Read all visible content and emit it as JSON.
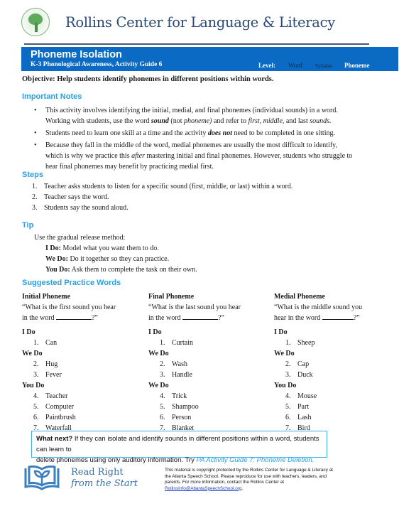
{
  "header": {
    "brand": "Rollins Center for Language & Literacy",
    "logo_icon": "tree-seal-icon"
  },
  "title_bar": {
    "title": "Phoneme Isolation",
    "subtitle": "K-3 Phonological Awareness, Activity Guide 6",
    "level_label": "Level:",
    "levels": [
      "Word",
      "Syllable",
      "Phoneme"
    ],
    "active_level": "Phoneme",
    "color": "#0b6bc4"
  },
  "objective": "Objective: Help students identify phonemes in different positions within words.",
  "important_notes": {
    "heading": "Important Notes",
    "items": [
      {
        "line1": "This activity involves identifying the initial, medial, and final phonemes (individual sounds) in a word.",
        "line2_a": "Working with students, use the word ",
        "line2_b": "sound",
        "line2_c": " (not ",
        "line2_d": "phoneme)",
        "line2_e": " and refer to ",
        "line2_f": "first, middle,",
        "line2_g": " and last ",
        "line2_h": "sounds."
      },
      {
        "a": "Students need to learn one skill at a time and the activity ",
        "b": "does not",
        "c": " need to be completed in one sitting."
      },
      {
        "line1": "Because they fall in the middle of the word, medial phonemes are usually the most difficult to identify,",
        "line2_a": "which is why we practice this ",
        "line2_b": "after",
        "line2_c": " mastering initial and final phonemes. However, students who struggle to",
        "line3": "hear final phonemes may benefit by practicing medial first."
      }
    ]
  },
  "steps": {
    "heading": "Steps",
    "items": [
      {
        "num": "1.",
        "text": "Teacher asks students to listen for a specific sound (first, middle, or last) within a word."
      },
      {
        "num": "2.",
        "text": "Teacher says the word."
      },
      {
        "num": "3.",
        "text": "Students say the sound aloud."
      }
    ]
  },
  "tip": {
    "heading": "Tip",
    "intro": "Use the gradual release method:",
    "rows": [
      {
        "label": "I Do:",
        "text": " Model what you want them to do."
      },
      {
        "label": "We Do:",
        "text": " Do it together so they can practice."
      },
      {
        "label": "You Do:",
        "text": " Ask them to complete the task on their own."
      }
    ]
  },
  "practice": {
    "heading": "Suggested Practice Words",
    "columns": [
      {
        "title": "Initial Phoneme",
        "prompt_line1": "“What is the first sound you hear",
        "prompt_line2": "in the word ",
        "prompt_end": "?”",
        "groups": [
          {
            "label": "I Do",
            "items": [
              {
                "num": "1.",
                "word": "Can"
              }
            ]
          },
          {
            "label": "We Do",
            "items": [
              {
                "num": "2.",
                "word": "Hug"
              },
              {
                "num": "3.",
                "word": "Fever"
              }
            ]
          },
          {
            "label": "You Do",
            "items": [
              {
                "num": "4.",
                "word": "Teacher"
              },
              {
                "num": "5.",
                "word": "Computer"
              },
              {
                "num": "6.",
                "word": "Paintbrush"
              },
              {
                "num": "7.",
                "word": "Waterfall"
              }
            ]
          }
        ]
      },
      {
        "title": "Final Phoneme",
        "prompt_line1": "“What is the last sound you hear",
        "prompt_line2": "in the word ",
        "prompt_end": "?”",
        "groups": [
          {
            "label": "I Do",
            "items": [
              {
                "num": "1.",
                "word": "Curtain"
              }
            ]
          },
          {
            "label": "We Do",
            "items": [
              {
                "num": "2.",
                "word": "Wash"
              },
              {
                "num": "3.",
                "word": "Handle"
              }
            ]
          },
          {
            "label": "We Do",
            "items": [
              {
                "num": "4.",
                "word": "Trick"
              },
              {
                "num": "5.",
                "word": "Shampoo"
              },
              {
                "num": "6.",
                "word": "Person"
              },
              {
                "num": "7.",
                "word": "Blanket"
              }
            ]
          }
        ]
      },
      {
        "title": "Medial Phoneme",
        "prompt_line1": "“What is the middle sound you",
        "prompt_line2": "hear in the word ",
        "prompt_end": "?”",
        "groups": [
          {
            "label": "I Do",
            "items": [
              {
                "num": "1.",
                "word": "Sheep"
              }
            ]
          },
          {
            "label": "We Do",
            "items": [
              {
                "num": "2.",
                "word": "Cap"
              },
              {
                "num": "3.",
                "word": "Duck"
              }
            ]
          },
          {
            "label": "You Do",
            "items": [
              {
                "num": "4.",
                "word": "Mouse"
              },
              {
                "num": "5.",
                "word": "Part"
              },
              {
                "num": "6.",
                "word": "Lash"
              },
              {
                "num": "7.",
                "word": "Bird"
              }
            ]
          }
        ]
      }
    ]
  },
  "what_next": {
    "lead": "What next?",
    "text1": " If they can isolate and identify sounds in different positions within a word, students can learn to",
    "text2": "delete phonemes using only auditory information. Try ",
    "link": "PA Activity Guide 7: Phoneme Deletion."
  },
  "footer": {
    "logo_icon": "open-book-sprout-icon",
    "rrfs_line1": "Read Right",
    "rrfs_line2": "from the Start",
    "copyright_line1": "This material is copyright protected by the Rollins Center for Language & Literacy at",
    "copyright_line2": "the Atlanta Speech School. Please reproduce for use with teachers, leaders, and",
    "copyright_line3": "parents. For more information, contact the Rollins Center at",
    "email": "RollinsInfo@AtlantaSpeechSchool.org",
    "email_end": "."
  }
}
